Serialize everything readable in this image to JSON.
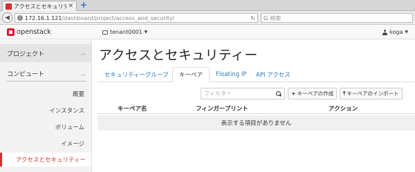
{
  "browser": {
    "tab_title": "アクセスとセキュリティ…",
    "tab_close": "✕",
    "new_tab": "+",
    "url_host": "172.16.1.121",
    "url_path": "/dashboard/project/access_and_security/",
    "search_placeholder": "検索",
    "search_engine_icon": "G"
  },
  "header": {
    "logo_text": "openstack",
    "tenant": "tenant0001",
    "user": "koga"
  },
  "sidebar": {
    "project": "プロジェクト",
    "compute": "コンピュート",
    "items": [
      "概要",
      "インスタンス",
      "ボリューム",
      "イメージ"
    ],
    "active_item": "アクセスとセキュリティー"
  },
  "main": {
    "title": "アクセスとセキュリティー",
    "tabs": [
      "セキュリティーグループ",
      "キーペア",
      "Floating IP",
      "API アクセス"
    ],
    "active_tab_index": 1,
    "filter_placeholder": "フィルター",
    "create_button": "キーペアの作成",
    "import_button": "キーペアのインポート",
    "columns": [
      "キーペア名",
      "フィンガープリント",
      "アクション"
    ],
    "empty_message": "表示する項目がありません"
  },
  "colors": {
    "accent_red": "#d0312d",
    "link_blue": "#2a7ab8"
  }
}
